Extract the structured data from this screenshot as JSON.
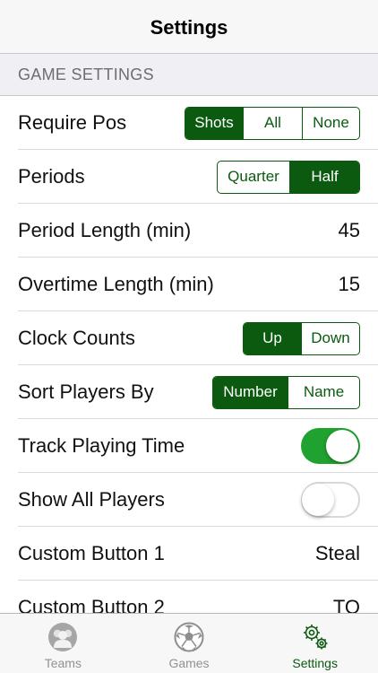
{
  "nav": {
    "title": "Settings"
  },
  "section": {
    "title": "GAME SETTINGS"
  },
  "rows": {
    "require_pos": {
      "label": "Require Pos",
      "options": [
        "Shots",
        "All",
        "None"
      ],
      "selected": "Shots"
    },
    "periods": {
      "label": "Periods",
      "options": [
        "Quarter",
        "Half"
      ],
      "selected": "Half"
    },
    "period_length": {
      "label": "Period Length (min)",
      "value": "45"
    },
    "overtime_length": {
      "label": "Overtime Length (min)",
      "value": "15"
    },
    "clock_counts": {
      "label": "Clock Counts",
      "options": [
        "Up",
        "Down"
      ],
      "selected": "Up"
    },
    "sort_players": {
      "label": "Sort Players By",
      "options": [
        "Number",
        "Name"
      ],
      "selected": "Number"
    },
    "track_playing_time": {
      "label": "Track Playing Time",
      "on": true
    },
    "show_all_players": {
      "label": "Show All Players",
      "on": false
    },
    "custom_button_1": {
      "label": "Custom Button 1",
      "value": "Steal"
    },
    "custom_button_2": {
      "label": "Custom Button 2",
      "value": "TO"
    }
  },
  "tabbar": {
    "teams": {
      "label": "Teams",
      "icon": "teams-icon"
    },
    "games": {
      "label": "Games",
      "icon": "soccer-ball-icon"
    },
    "settings": {
      "label": "Settings",
      "icon": "gears-icon",
      "active": true
    }
  },
  "colors": {
    "accent": "#0b5a10",
    "toggle_on": "#1fa22f",
    "inactive_tab": "#929292"
  }
}
